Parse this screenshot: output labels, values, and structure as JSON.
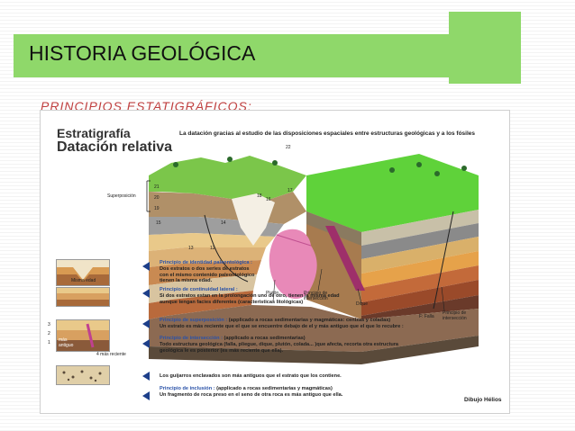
{
  "slide": {
    "title": "HISTORIA GEOLÓGICA",
    "subtitle": "PRINCIPIOS ESTATIGRÁFICOS:"
  },
  "figure": {
    "heading_line1": "Estratigrafía",
    "heading_line2": "Datación relativa",
    "caption": "La datación gracias al estudio de las disposiciones espaciales entre estructuras geológicas y a los fósiles",
    "labels": {
      "superposicion": "Superposición",
      "pluton": "Plutón",
      "principio_interseccion_a": "Principio de intersección",
      "dique": "Dique",
      "falla": "F: Falla",
      "principio_interseccion_b": "Principio de intersección",
      "misma_edad": "Misma edad",
      "mas_reciente_3": "3",
      "mas_reciente_2": "2",
      "mas_reciente_1": "1",
      "mas": "más",
      "antiguo": "antiguo",
      "mas_reciente": "4 más reciente"
    },
    "principles": [
      {
        "head": "Principio de identidad paleontológica :",
        "lines": [
          "Dos estratos o dos series de estratos",
          "con el mismo contenido paleontológico",
          "tienen la misma edad."
        ]
      },
      {
        "head": "Principio de continuidad lateral :",
        "lines": [
          "Si dos estratos estan en la prolongación uno de otro, tienen la misma edad",
          "aunque tengan facies diferentes (caracteristicas litológicas)"
        ]
      },
      {
        "head": "Principio de superposición :",
        "tail": "(applicado a rocas sedimentarias y magmáticas: cenizas y coladas)",
        "lines": [
          "Un estrato es más reciente que el que se encuentre debajo de el y más antiguo que el que lo recubre :"
        ]
      },
      {
        "head": "Principio de intersección :",
        "tail": "(applicado a rocas sedimentarias)",
        "lines": [
          "Todo estructura geológica (falla, pliegue, dique, plutón, colada... )que afecta, recorta otra estructura",
          "geológica le es posterior (es más reciente que ella)."
        ]
      },
      {
        "head": "",
        "lines": [
          "Los guijarros enclavados son más antiguos que el estrato que los contiene."
        ]
      },
      {
        "head": "Principio de inclusión :",
        "tail": "(applicado a rocas sedimentarias y magmáticas)",
        "lines": [
          "Un fragmento de roca preso en el seno de otra roca es más antiguo que ella."
        ]
      }
    ],
    "layer_numbers": [
      "22",
      "21",
      "20",
      "19",
      "18",
      "17",
      "16",
      "15",
      "14",
      "13",
      "12"
    ],
    "credit": "Dibujo Hélios"
  },
  "colors": {
    "accent_green": "#8fd86a",
    "subtitle_red": "#c04040",
    "principle_blue": "#2a52a8",
    "arrow_navy": "#1d3f8a"
  }
}
